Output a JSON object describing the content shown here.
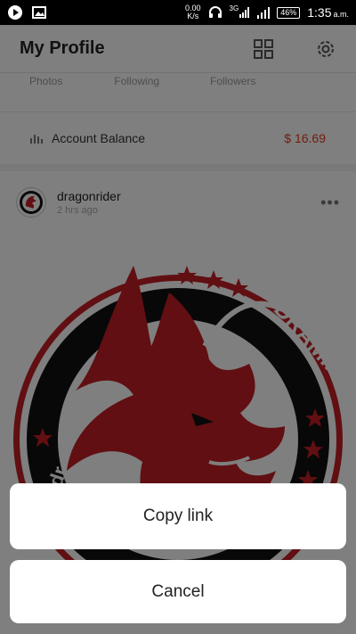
{
  "status_bar": {
    "speed_value": "0.00",
    "speed_unit": "K/s",
    "network_type": "3G",
    "battery": "46%",
    "time": "1:35",
    "ampm": "a.m."
  },
  "header": {
    "title": "My Profile",
    "grid_icon": "grid-icon",
    "settings_icon": "gear-icon"
  },
  "stats": [
    "Photos",
    "Following",
    "Followers"
  ],
  "balance": {
    "label": "Account Balance",
    "value": "$ 16.69",
    "icon": "bar-chart-icon"
  },
  "post": {
    "username": "dragonrider",
    "time_ago": "2 hrs ago",
    "more_icon": "more-dots-icon",
    "image_text_top": "DRAMIRS",
    "image_text_left": "@dr"
  },
  "sheet": {
    "copy_link": "Copy link",
    "cancel": "Cancel"
  },
  "colors": {
    "overlay": "#000000",
    "balance_value": "#e03c1f",
    "logo_red": "#c21f24",
    "logo_black": "#111111"
  }
}
